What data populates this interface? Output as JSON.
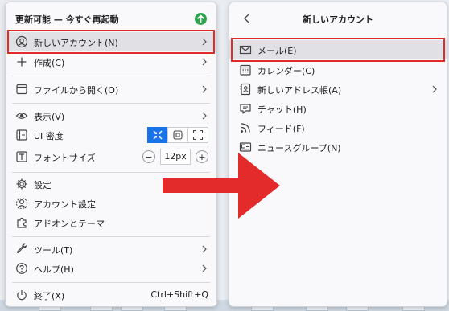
{
  "left_menu": {
    "update_text": "更新可能 — 今すぐ再起動",
    "new_account": "新しいアカウント(N)",
    "create": "作成(C)",
    "open_file": "ファイルから開く(O)",
    "view": "表示(V)",
    "ui_density": "UI 密度",
    "font_size": "フォントサイズ",
    "font_size_value": "12px",
    "zoom_out": "−",
    "zoom_in": "+",
    "settings": "設定",
    "account_settings": "アカウント設定",
    "addons_themes": "アドオンとテーマ",
    "tools": "ツール(T)",
    "help": "ヘルプ(H)",
    "quit": "終了(X)",
    "quit_shortcut": "Ctrl+Shift+Q"
  },
  "right_menu": {
    "title": "新しいアカウント",
    "items": [
      {
        "label": "メール(E)",
        "icon": "mail-icon"
      },
      {
        "label": "カレンダー(C)",
        "icon": "calendar-icon"
      },
      {
        "label": "新しいアドレス帳(A)",
        "icon": "address-book-icon"
      },
      {
        "label": "チャット(H)",
        "icon": "chat-icon"
      },
      {
        "label": "フィード(F)",
        "icon": "feed-icon"
      },
      {
        "label": "ニュースグループ(N)",
        "icon": "newsgroup-icon"
      }
    ]
  },
  "colors": {
    "highlight_border": "#e02b2b",
    "arrow": "#e32b2b",
    "update_badge": "#2ea44f",
    "density_active": "#1a73e8"
  }
}
